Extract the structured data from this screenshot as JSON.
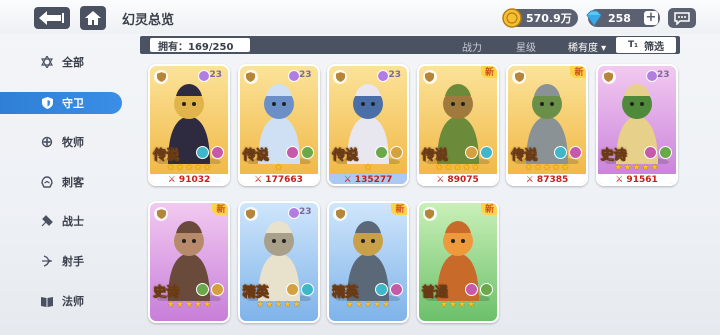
{
  "header": {
    "title": "幻灵总览",
    "gold": "570.9万",
    "gems": "258",
    "plus": "+"
  },
  "filter": {
    "owned": "拥有：169/250",
    "expand": "+",
    "sort_power": "战力",
    "sort_level": "星级",
    "sort_rarity": "稀有度 ▾",
    "filter_label": "筛选",
    "filter_prefix": "T₁"
  },
  "sidebar": {
    "items": [
      {
        "label": "全部",
        "icon": "star-of-david-icon"
      },
      {
        "label": "守卫",
        "icon": "shield-icon"
      },
      {
        "label": "牧师",
        "icon": "priest-icon"
      },
      {
        "label": "刺客",
        "icon": "assassin-icon"
      },
      {
        "label": "战士",
        "icon": "warrior-icon"
      },
      {
        "label": "射手",
        "icon": "archer-icon"
      },
      {
        "label": "法师",
        "icon": "book-icon"
      }
    ],
    "active_index": 1
  },
  "colors": {
    "legend": "#f6c64c",
    "epic": "#d78fe3",
    "elite": "#8fc2f2",
    "common": "#7ecb7b",
    "power_red": "#c6201e",
    "sidebar_active": "#3a8ee6"
  },
  "cards": [
    {
      "name": "anubis",
      "rarity": "传说",
      "level": "23",
      "power": "91032",
      "stars": 5,
      "new": false,
      "tier": "legend",
      "power_blue": false
    },
    {
      "name": "antelope-maiden",
      "rarity": "传说",
      "level": "23",
      "power": "177663",
      "stars": 1,
      "new": false,
      "tier": "legend",
      "power_blue": false
    },
    {
      "name": "wolf-huntress",
      "rarity": "传说",
      "level": "23",
      "power": "135277",
      "stars": 1,
      "new": false,
      "tier": "legend",
      "power_blue": true
    },
    {
      "name": "treant",
      "rarity": "传说",
      "level": "",
      "power": "89075",
      "stars": 5,
      "new": true,
      "tier": "legend",
      "power_blue": false
    },
    {
      "name": "stone-golem",
      "rarity": "传说",
      "level": "",
      "power": "87385",
      "stars": 5,
      "new": true,
      "tier": "legend",
      "power_blue": false
    },
    {
      "name": "dryad",
      "rarity": "史诗",
      "level": "23",
      "power": "91561",
      "stars": 5,
      "new": false,
      "tier": "epic",
      "power_blue": false
    },
    {
      "name": "minotaur",
      "rarity": "史诗",
      "level": "",
      "power": "",
      "stars": 5,
      "new": true,
      "tier": "epic",
      "power_blue": false
    },
    {
      "name": "mummy",
      "rarity": "精英",
      "level": "23",
      "power": "",
      "stars": 5,
      "new": false,
      "tier": "elite",
      "power_blue": false
    },
    {
      "name": "dwarf",
      "rarity": "精英",
      "level": "",
      "power": "",
      "stars": 5,
      "new": true,
      "tier": "elite",
      "power_blue": false
    },
    {
      "name": "slime",
      "rarity": "普通",
      "level": "",
      "power": "",
      "stars": 4,
      "new": true,
      "tier": "common",
      "power_blue": false
    }
  ],
  "new_label": "新"
}
